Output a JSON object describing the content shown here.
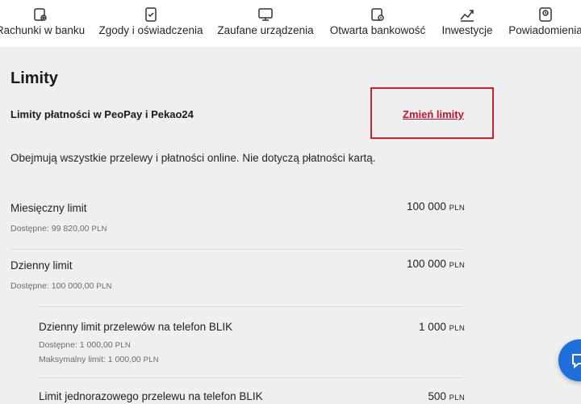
{
  "nav": {
    "items": [
      {
        "label": "Rachunki w banku",
        "icon": "accounts-settings-icon"
      },
      {
        "label": "Zgody i oświadczenia",
        "icon": "consents-document-icon"
      },
      {
        "label": "Zaufane urządzenia",
        "icon": "monitor-icon"
      },
      {
        "label": "Otwarta bankowość",
        "icon": "open-banking-icon"
      },
      {
        "label": "Inwestycje",
        "icon": "chart-trend-icon"
      },
      {
        "label": "Powiadomienia",
        "icon": "notifications-icon"
      }
    ]
  },
  "page": {
    "title": "Limity",
    "section_title": "Limity płatności w PeoPay i Pekao24",
    "change_link": "Zmień limity",
    "description": "Obejmują wszystkie przelewy i płatności online. Nie dotyczą płatności kartą."
  },
  "limits": [
    {
      "name": "Miesięczny limit",
      "value": "100 000",
      "currency": "PLN",
      "available_label": "Dostępne:",
      "available": "99 820,00",
      "available_currency": "PLN"
    },
    {
      "name": "Dzienny limit",
      "value": "100 000",
      "currency": "PLN",
      "available_label": "Dostępne:",
      "available": "100 000,00",
      "available_currency": "PLN"
    },
    {
      "name": "Dzienny limit przelewów na telefon BLIK",
      "value": "1 000",
      "currency": "PLN",
      "available_label": "Dostępne:",
      "available": "1 000,00",
      "available_currency": "PLN",
      "max_label": "Maksymalny limit:",
      "max": "1 000,00",
      "max_currency": "PLN"
    },
    {
      "name": "Limit jednorazowego przelewu na telefon BLIK",
      "value": "500",
      "currency": "PLN"
    }
  ],
  "colors": {
    "accent_red": "#c8102e",
    "highlight_border": "#d1202a",
    "chat_blue": "#1e6fd9"
  },
  "chat": {
    "icon": "chat-bubble-icon"
  }
}
